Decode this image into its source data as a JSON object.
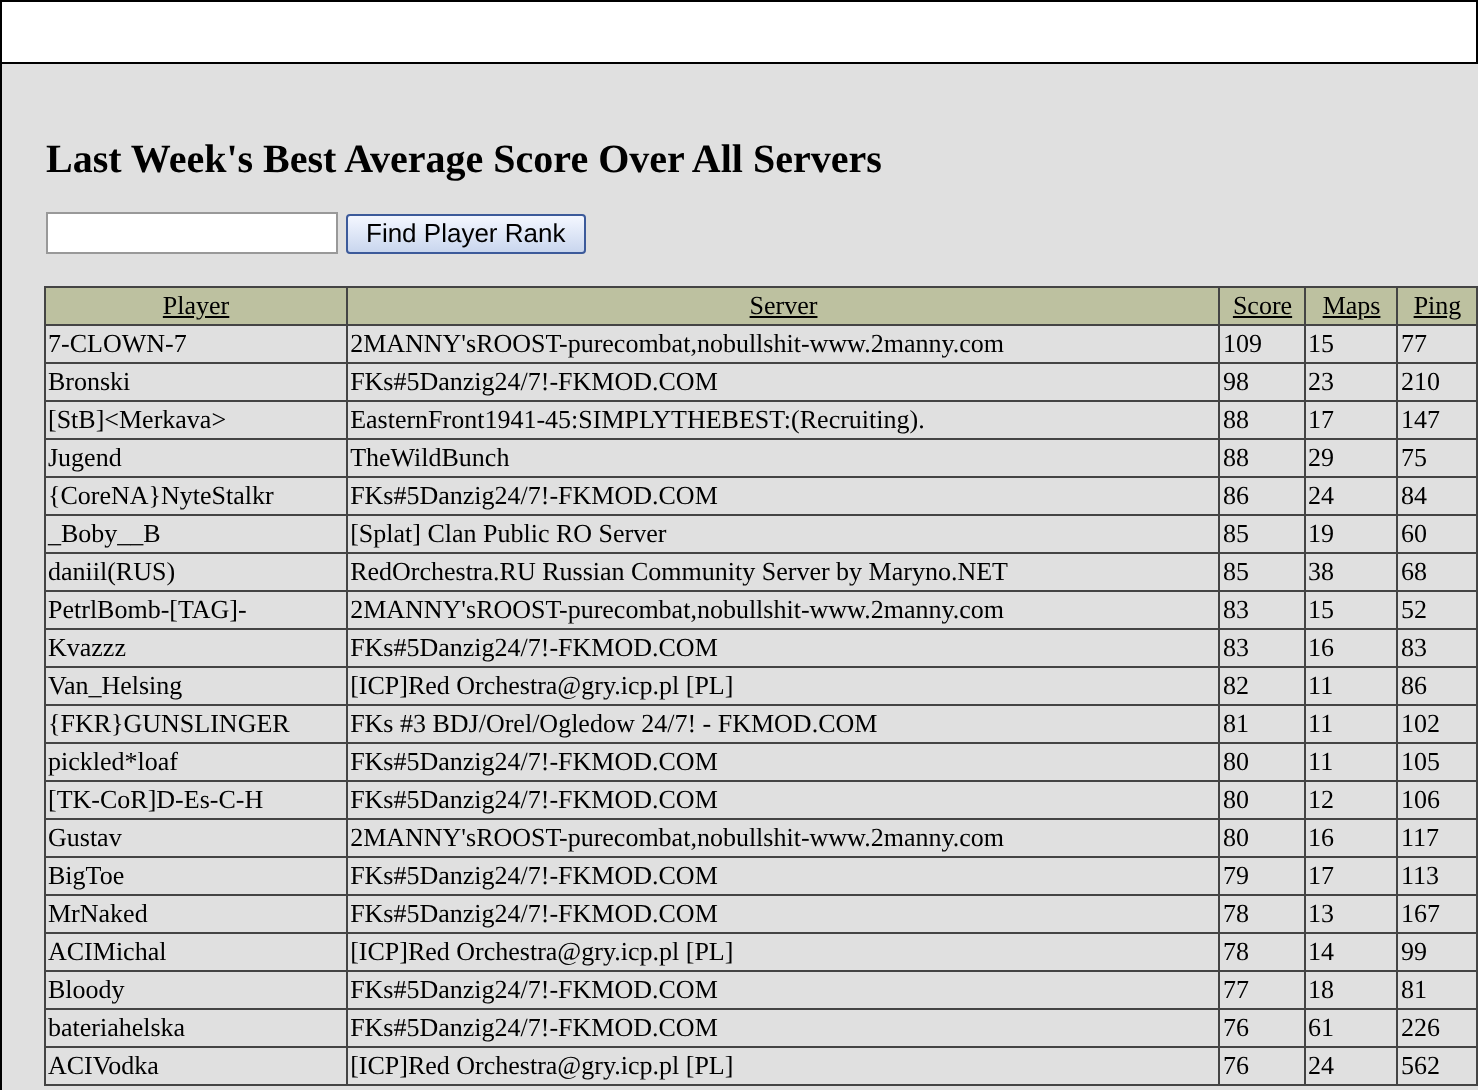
{
  "title": "Last Week's Best Average Score Over All Servers",
  "search": {
    "button": "Find Player Rank"
  },
  "table": {
    "columns": [
      "Player",
      "Server",
      "Score",
      "Maps",
      "Ping"
    ],
    "rows": [
      [
        "7-CLOWN-7",
        "2MANNY'sROOST-purecombat,nobullshit-www.2manny.com",
        "109",
        "15",
        "77"
      ],
      [
        "Bronski",
        "FKs#5Danzig24/7!-FKMOD.COM",
        "98",
        "23",
        "210"
      ],
      [
        "[StB]<Merkava>",
        "EasternFront1941-45:SIMPLYTHEBEST:(Recruiting).",
        "88",
        "17",
        "147"
      ],
      [
        "Jugend",
        "TheWildBunch",
        "88",
        "29",
        "75"
      ],
      [
        "{CoreNA}NyteStalkr",
        "FKs#5Danzig24/7!-FKMOD.COM",
        "86",
        "24",
        "84"
      ],
      [
        "_Boby__B",
        "[Splat] Clan Public RO Server",
        "85",
        "19",
        "60"
      ],
      [
        "daniil(RUS)",
        "RedOrchestra.RU Russian Community Server by Maryno.NET",
        "85",
        "38",
        "68"
      ],
      [
        "PetrlBomb-[TAG]-",
        "2MANNY'sROOST-purecombat,nobullshit-www.2manny.com",
        "83",
        "15",
        "52"
      ],
      [
        "Kvazzz",
        "FKs#5Danzig24/7!-FKMOD.COM",
        "83",
        "16",
        "83"
      ],
      [
        "Van_Helsing",
        "[ICP]Red Orchestra@gry.icp.pl [PL]",
        "82",
        "11",
        "86"
      ],
      [
        "{FKR}GUNSLINGER",
        "FKs #3 BDJ/Orel/Ogledow 24/7! - FKMOD.COM",
        "81",
        "11",
        "102"
      ],
      [
        "pickled*loaf",
        "FKs#5Danzig24/7!-FKMOD.COM",
        "80",
        "11",
        "105"
      ],
      [
        "[TK-CoR]D-Es-C-H",
        "FKs#5Danzig24/7!-FKMOD.COM",
        "80",
        "12",
        "106"
      ],
      [
        "Gustav",
        "2MANNY'sROOST-purecombat,nobullshit-www.2manny.com",
        "80",
        "16",
        "117"
      ],
      [
        "BigToe",
        "FKs#5Danzig24/7!-FKMOD.COM",
        "79",
        "17",
        "113"
      ],
      [
        "MrNaked",
        "FKs#5Danzig24/7!-FKMOD.COM",
        "78",
        "13",
        "167"
      ],
      [
        "ACIMichal",
        "[ICP]Red Orchestra@gry.icp.pl [PL]",
        "78",
        "14",
        "99"
      ],
      [
        "Bloody",
        "FKs#5Danzig24/7!-FKMOD.COM",
        "77",
        "18",
        "81"
      ],
      [
        "bateriahelska",
        "FKs#5Danzig24/7!-FKMOD.COM",
        "76",
        "61",
        "226"
      ],
      [
        "ACIVodka",
        "[ICP]Red Orchestra@gry.icp.pl [PL]",
        "76",
        "24",
        "562"
      ]
    ]
  }
}
